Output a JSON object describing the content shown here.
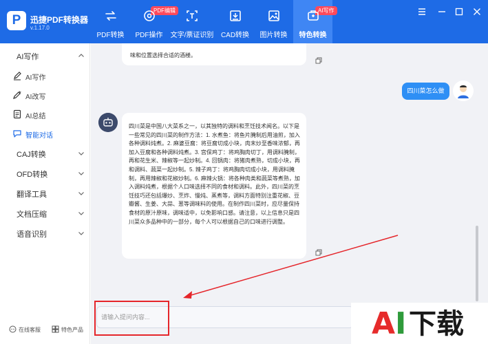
{
  "app": {
    "logo_letter": "P",
    "name": "迅捷PDF转换器",
    "version": "v.1.17.0"
  },
  "nav": [
    {
      "label": "PDF转换",
      "icon": "swap-icon"
    },
    {
      "label": "PDF操作",
      "icon": "pdf-gear-icon",
      "badge": "PDF编辑"
    },
    {
      "label": "文字/票证识别",
      "icon": "scan-text-icon"
    },
    {
      "label": "CAD转换",
      "icon": "cad-icon"
    },
    {
      "label": "图片转换",
      "icon": "image-icon"
    },
    {
      "label": "特色转换",
      "icon": "feature-icon",
      "badge": "AI写作",
      "active": true
    }
  ],
  "sidebar": {
    "groups": [
      {
        "label": "AI写作",
        "expanded": true
      },
      {
        "label": "CAJ转换"
      },
      {
        "label": "OFD转换"
      },
      {
        "label": "翻译工具"
      },
      {
        "label": "文档压缩"
      },
      {
        "label": "语音识别"
      }
    ],
    "ai_items": [
      {
        "label": "AI写作",
        "icon": "pen-icon"
      },
      {
        "label": "AI改写",
        "icon": "edit-icon"
      },
      {
        "label": "AI总结",
        "icon": "summary-icon"
      },
      {
        "label": "智能对话",
        "icon": "chat-icon",
        "active": true
      }
    ],
    "footer": [
      {
        "label": "在线客服",
        "icon": "headset-icon"
      },
      {
        "label": "特色产品",
        "icon": "grid-icon"
      }
    ]
  },
  "chat": {
    "previous_reply_tail": "味和位置选择合适的酒楼。",
    "user_message": "四川菜怎么做",
    "bot_reply": "四川菜是中国八大菜系之一，以其独特的调料和烹饪技术闻名。以下是一些常见的四川菜的制作方法：1. 水煮鱼：将鱼片腌制后用油煎，加入各种调料炖煮。2. 麻婆豆腐：将豆腐切成小块，肉末炒至香味浓郁，再加入豆腐和各种调料炖煮。3. 宫保鸡丁：将鸡胸肉切丁，用调料腌制，再和花生米、辣椒等一起炒制。4. 回锅肉：将猪肉煮熟，切成小块，再和调料、蔬菜一起炒制。5. 辣子鸡丁：将鸡胸肉切成小块，用调料腌制，再用辣椒和花椒炒制。6. 麻辣火锅：将各种肉类和蔬菜等煮熟，加入调料炖煮，根据个人口味选择不同的食材和调料。此外，四川菜的烹饪技巧还包括爆炒、烹炸、慢炖、蒸煮等，调料方面特别注重花椒、豆瓣酱、生姜、大蒜、葱等调味料的使用。在制作四川菜时，应尽量保持食材的原汁原味，调味适中，以免影响口感。请注意，以上信息只是四川菜众多品种中的一部分，每个人可以根据自己的口味进行调整。",
    "input_placeholder": "请输入提问内容...",
    "input_value": ""
  },
  "colors": {
    "header": "#1e6be6",
    "active_tab": "#3f86f4",
    "badge": "#ff4a5c",
    "user_bubble": "#2e8ff5",
    "annotation": "#e5252a"
  },
  "watermark": {
    "a": "A",
    "i": "I",
    "rest": "下载"
  }
}
